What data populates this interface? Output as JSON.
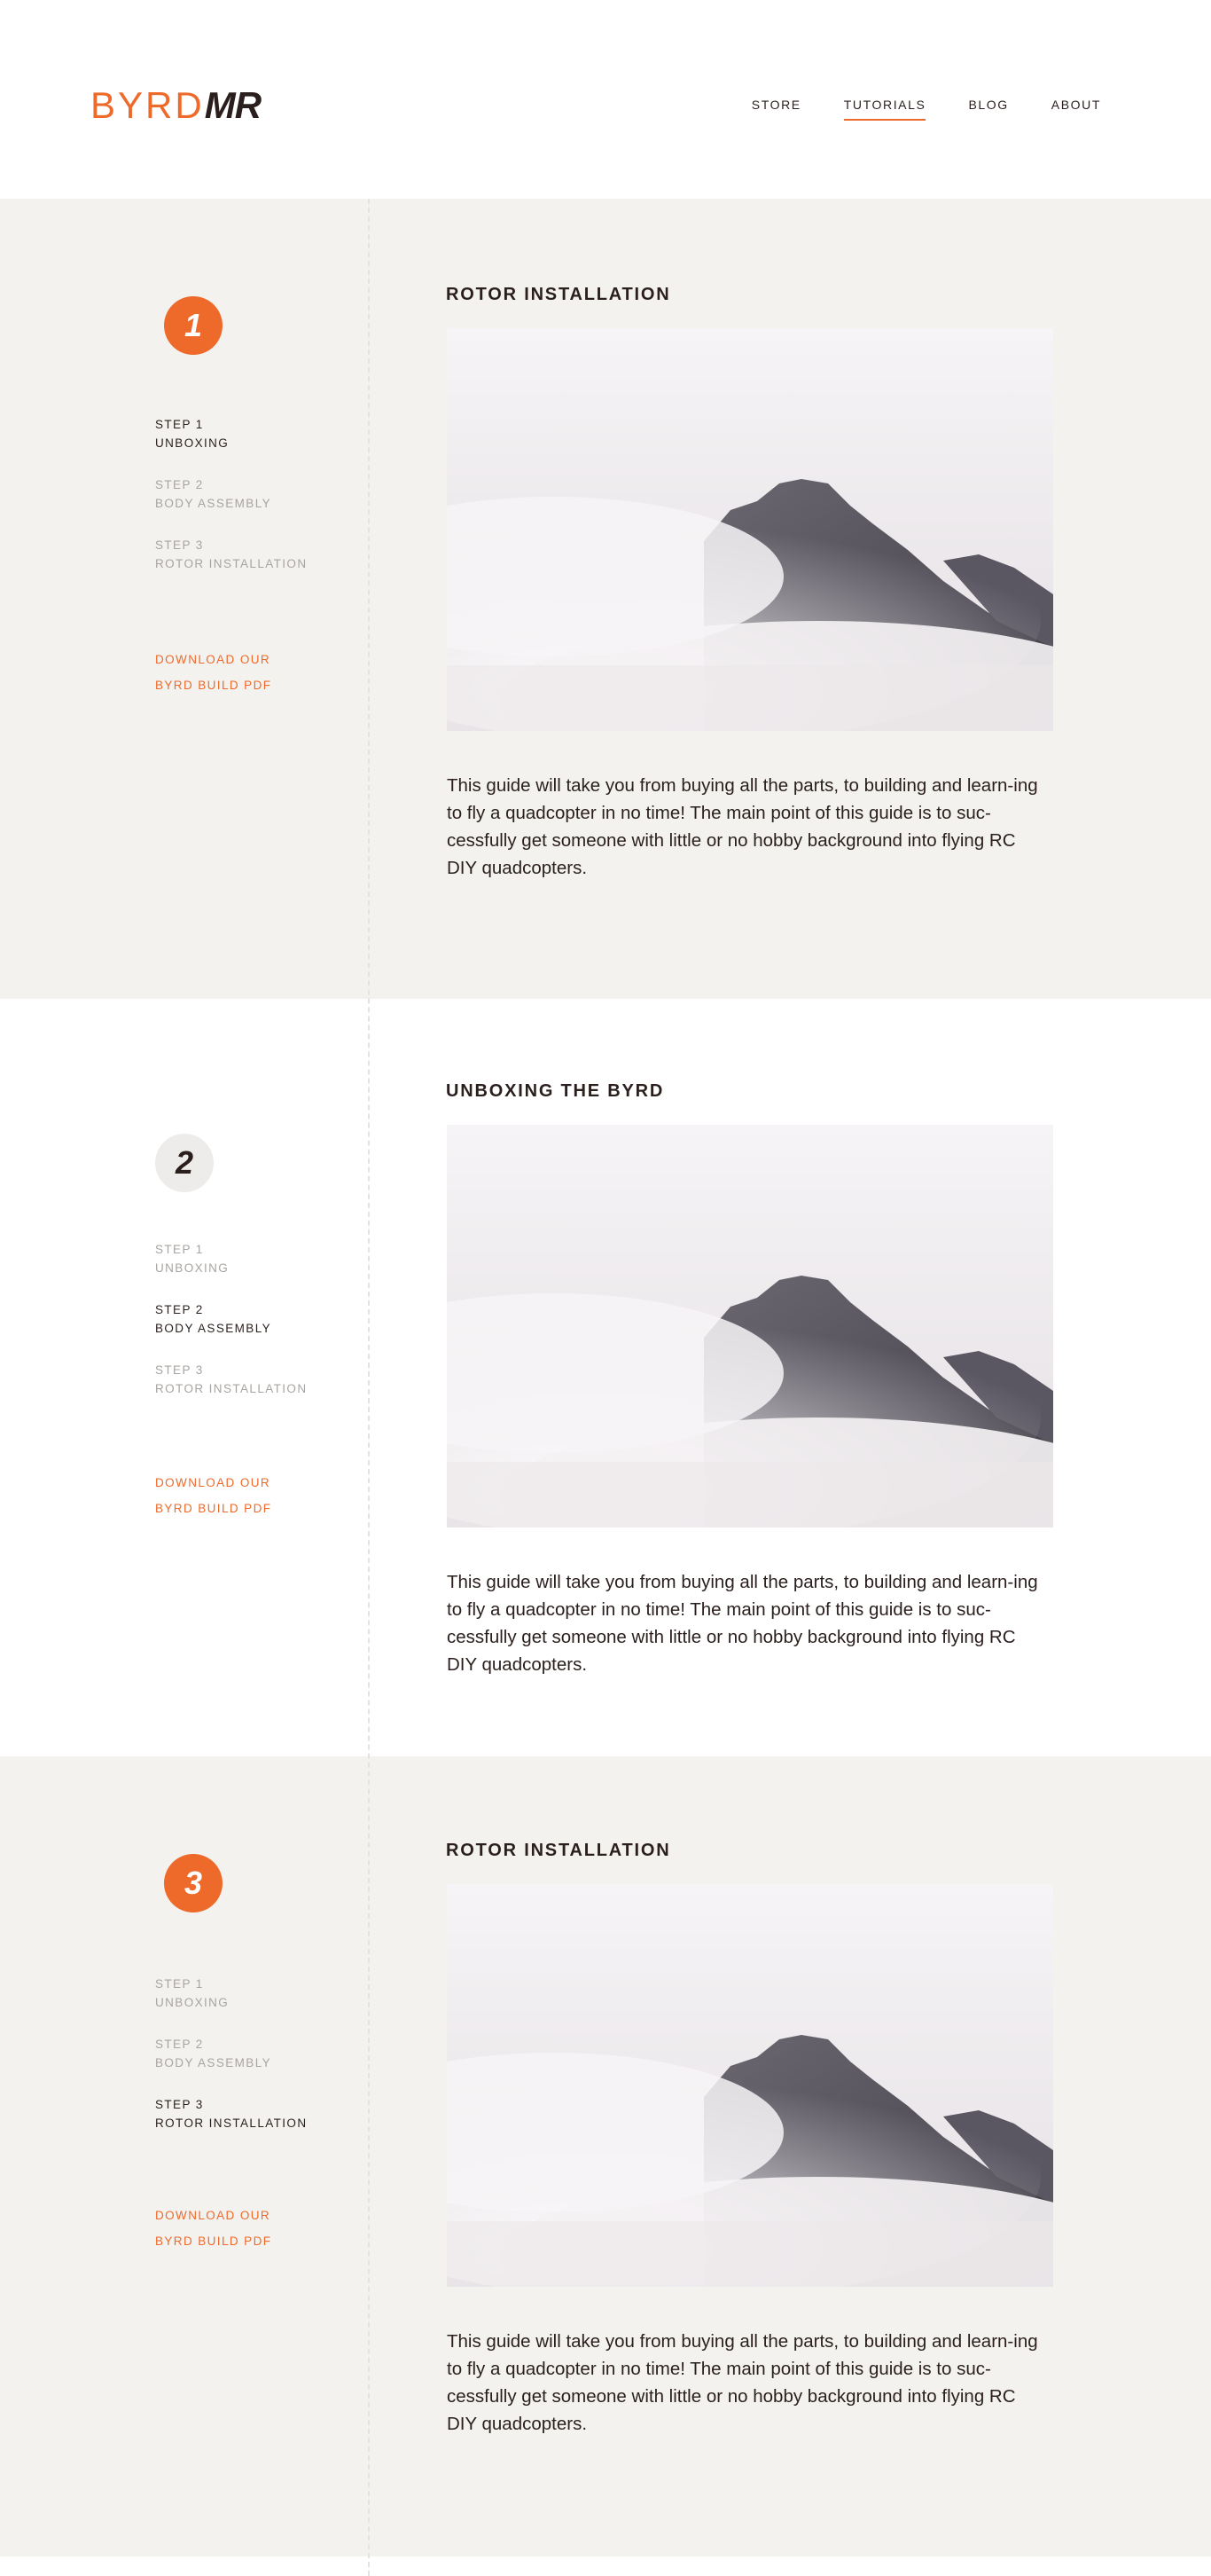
{
  "logo": {
    "part_a": "BYRD",
    "part_b": "MR"
  },
  "nav": [
    {
      "label": "STORE",
      "active": false
    },
    {
      "label": "TUTORIALS",
      "active": true
    },
    {
      "label": "BLOG",
      "active": false
    },
    {
      "label": "ABOUT",
      "active": false
    }
  ],
  "steps": [
    {
      "line1": "STEP 1",
      "line2": "UNBOXING"
    },
    {
      "line1": "STEP 2",
      "line2": "BODY ASSEMBLY"
    },
    {
      "line1": "STEP 3",
      "line2": "ROTOR INSTALLATION"
    }
  ],
  "download": {
    "line1": "DOWNLOAD OUR",
    "line2": "BYRD BUILD PDF"
  },
  "sections": [
    {
      "badge": "1",
      "title": "ROTOR INSTALLATION",
      "body": "This guide will take you from buying all the parts, to building and learn-ing to fly a quadcopter in no time! The main point of this guide is to suc-cessfully get someone with little or no hobby background into flying RC DIY quadcopters.",
      "current_step": 0
    },
    {
      "badge": "2",
      "title": "UNBOXING THE BYRD",
      "body": "This guide will take you from buying all the parts, to building and learn-ing to fly a quadcopter in no time! The main point of this guide is to suc-cessfully get someone with little or no hobby background into flying RC DIY quadcopters.",
      "current_step": 1
    },
    {
      "badge": "3",
      "title": "ROTOR INSTALLATION",
      "body": "This guide will take you from buying all the parts, to building and learn-ing to fly a quadcopter in no time! The main point of this guide is to suc-cessfully get someone with little or no hobby background into flying RC DIY quadcopters.",
      "current_step": 2
    }
  ],
  "colors": {
    "accent": "#ee6a2b",
    "dark": "#2a1f1c",
    "muted": "#a8a4a1",
    "section_gray": "#f3f2ef"
  },
  "image": {
    "subject": "mountain-peak-in-clouds"
  }
}
